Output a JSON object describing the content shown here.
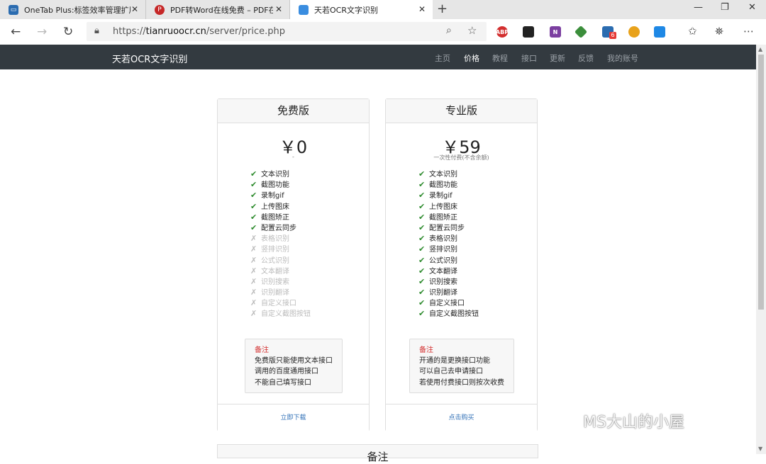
{
  "browser": {
    "tabs": [
      {
        "title": "OneTab Plus:标签效率管理扩展",
        "favicon": "onetab-icon"
      },
      {
        "title": "PDF转Word在线免费 – PDF在线转",
        "favicon": "pdf-icon"
      },
      {
        "title": "天若OCR文字识别",
        "favicon": "page-icon"
      }
    ],
    "new_tab": "+",
    "close_glyph": "✕",
    "window_controls": {
      "minimize": "—",
      "restore": "❐",
      "close": "✕"
    },
    "url_scheme": "https://",
    "url_host": "tianruoocr.cn",
    "url_path": "/server/price.php",
    "extensions": [
      {
        "name": "abp-icon",
        "label": "ABP",
        "color": "#d32f2f"
      },
      {
        "name": "ext-cat-icon",
        "label": "",
        "color": "#222222"
      },
      {
        "name": "onenote-icon",
        "label": "N",
        "color": "#7b3fa0"
      },
      {
        "name": "ext-cube-icon",
        "label": "",
        "color": "#3b8e3b"
      },
      {
        "name": "ext-grid-icon",
        "label": "",
        "color": "#2b6cb0"
      },
      {
        "name": "ext-ball-icon",
        "label": "",
        "color": "#e8a21b"
      },
      {
        "name": "ext-monitor-icon",
        "label": "",
        "color": "#1e88e5"
      }
    ],
    "badge_count": "6"
  },
  "site": {
    "brand": "天若OCR文字识别",
    "nav": [
      "主页",
      "价格",
      "教程",
      "接口",
      "更新",
      "反馈",
      "我的账号"
    ],
    "active_nav": "价格"
  },
  "plans": [
    {
      "name": "免费版",
      "price": "￥0",
      "subtitle": "-",
      "features": [
        {
          "label": "文本识别",
          "included": true
        },
        {
          "label": "截图功能",
          "included": true
        },
        {
          "label": "录制gif",
          "included": true
        },
        {
          "label": "上传图床",
          "included": true
        },
        {
          "label": "截图矫正",
          "included": true
        },
        {
          "label": "配置云同步",
          "included": true
        },
        {
          "label": "表格识别",
          "included": false
        },
        {
          "label": "竖排识别",
          "included": false
        },
        {
          "label": "公式识别",
          "included": false
        },
        {
          "label": "文本翻译",
          "included": false
        },
        {
          "label": "识别搜索",
          "included": false
        },
        {
          "label": "识别翻译",
          "included": false
        },
        {
          "label": "自定义接口",
          "included": false
        },
        {
          "label": "自定义截图按钮",
          "included": false
        }
      ],
      "note_title": "备注",
      "note_lines": [
        "免费版只能使用文本接口",
        "调用的百度通用接口",
        "不能自己填写接口"
      ],
      "action": "立即下载"
    },
    {
      "name": "专业版",
      "price": "￥59",
      "subtitle": "一次性付费(不含余额)",
      "features": [
        {
          "label": "文本识别",
          "included": true
        },
        {
          "label": "截图功能",
          "included": true
        },
        {
          "label": "录制gif",
          "included": true
        },
        {
          "label": "上传图床",
          "included": true
        },
        {
          "label": "截图矫正",
          "included": true
        },
        {
          "label": "配置云同步",
          "included": true
        },
        {
          "label": "表格识别",
          "included": true
        },
        {
          "label": "竖排识别",
          "included": true
        },
        {
          "label": "公式识别",
          "included": true
        },
        {
          "label": "文本翻译",
          "included": true
        },
        {
          "label": "识别搜索",
          "included": true
        },
        {
          "label": "识别翻译",
          "included": true
        },
        {
          "label": "自定义接口",
          "included": true
        },
        {
          "label": "自定义截图按钮",
          "included": true
        }
      ],
      "note_title": "备注",
      "note_lines": [
        "开通的是更换接口功能",
        "可以自己去申请接口",
        "若使用付费接口则按次收费"
      ],
      "action": "点击购买"
    }
  ],
  "bottom_card_title": "备注",
  "watermark": "MS大山的小屋"
}
